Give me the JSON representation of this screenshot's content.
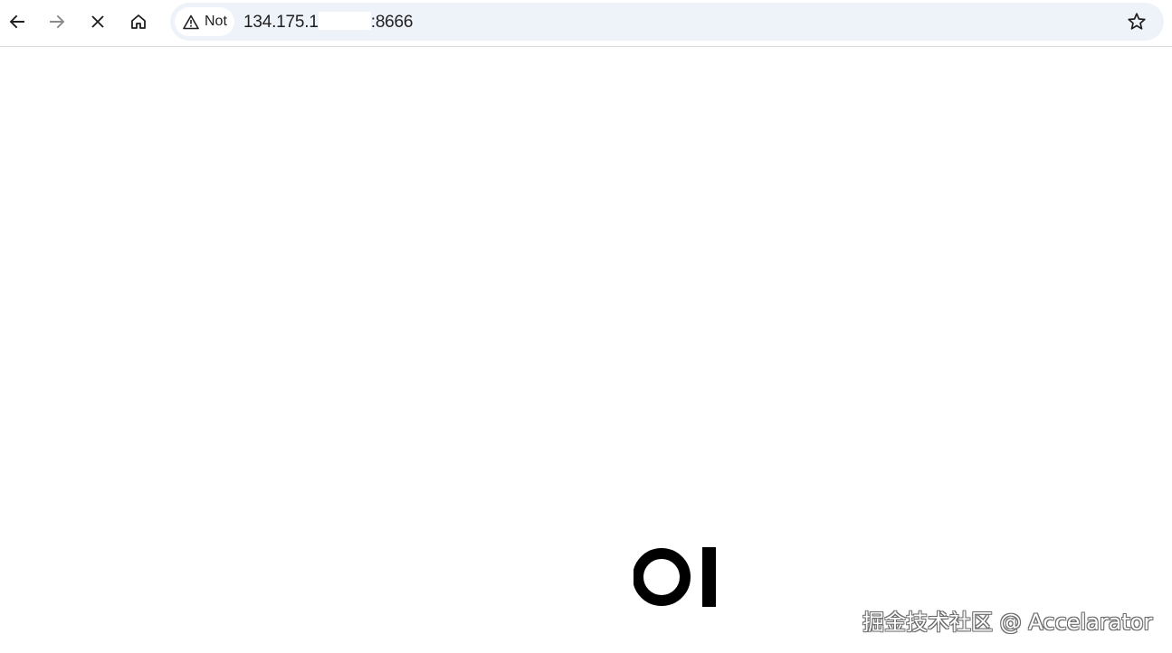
{
  "browser": {
    "nav": {
      "back_icon": "arrow-left-icon",
      "forward_icon": "arrow-right-icon",
      "stop_icon": "close-icon",
      "home_icon": "home-icon"
    },
    "omnibox": {
      "security_chip": {
        "icon": "warning-triangle-icon",
        "label": "Not"
      },
      "url_prefix": "134.175.1",
      "url_suffix": ":8666",
      "bookmark_icon": "star-icon"
    }
  },
  "page": {
    "logo_text": "OI",
    "watermark": "掘金技术社区 @ Accelarator"
  },
  "colors": {
    "omnibox_bg": "#eef2f9",
    "icon": "#1f1f1f",
    "disabled_icon": "#8a8a8a",
    "logo": "#000000"
  }
}
